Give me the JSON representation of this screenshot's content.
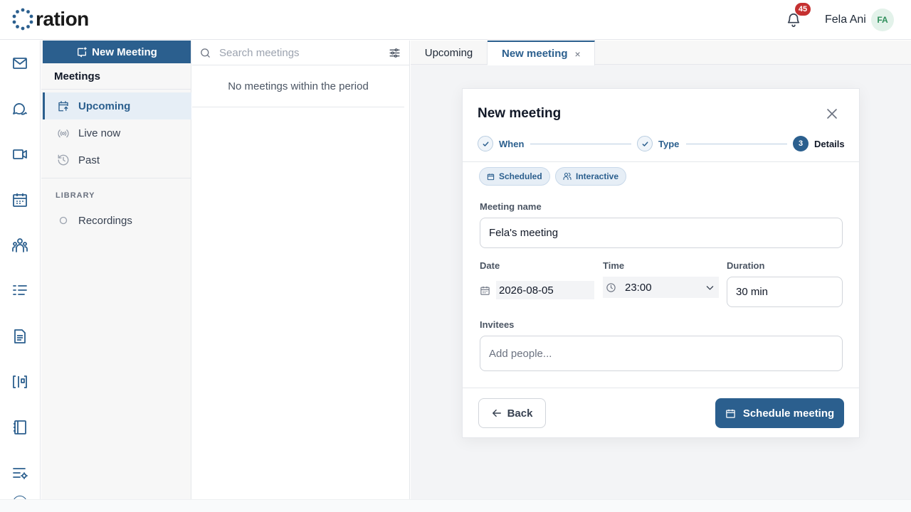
{
  "app": {
    "logo_text": "ration",
    "brand_color": "#2b5f8e"
  },
  "header": {
    "notification_count": "45",
    "user_name": "Fela Ani",
    "user_initials": "FA"
  },
  "rail": {
    "icons": [
      "mail-icon",
      "chat-icon",
      "video-icon",
      "calendar-icon",
      "people-icon",
      "tasks-icon",
      "document-icon",
      "whiteboard-icon",
      "notebook-icon",
      "settings-list-icon"
    ]
  },
  "nav": {
    "new_meeting_label": "New Meeting",
    "title": "Meetings",
    "items": [
      {
        "label": "Upcoming",
        "icon": "calendar-upcoming-icon",
        "active": true
      },
      {
        "label": "Live now",
        "icon": "broadcast-icon",
        "active": false
      },
      {
        "label": "Past",
        "icon": "history-icon",
        "active": false
      }
    ],
    "library_label": "LIBRARY",
    "library_items": [
      {
        "label": "Recordings",
        "icon": "circle-icon"
      }
    ]
  },
  "list": {
    "search_placeholder": "Search meetings",
    "empty_message": "No meetings within the period"
  },
  "tabs": [
    {
      "label": "Upcoming"
    },
    {
      "label": "New meeting",
      "close": "×"
    }
  ],
  "dialog": {
    "title": "New meeting",
    "steps": [
      {
        "number": "",
        "label": "When",
        "state": "done"
      },
      {
        "number": "",
        "label": "Type",
        "state": "done"
      },
      {
        "number": "3",
        "label": "Details",
        "state": "active"
      }
    ],
    "chips": [
      {
        "label": "Scheduled",
        "icon": "calendar-icon"
      },
      {
        "label": "Interactive",
        "icon": "people-icon"
      }
    ],
    "meeting_name_label": "Meeting name",
    "meeting_name_value": "Fela's meeting",
    "date_label": "Date",
    "date_value": "2026-08-05",
    "time_label": "Time",
    "time_value": "23:00",
    "duration_label": "Duration",
    "duration_value": "30 min",
    "invitees_label": "Invitees",
    "invitees_placeholder": "Add people...",
    "back_label": "Back",
    "schedule_label": "Schedule meeting"
  }
}
